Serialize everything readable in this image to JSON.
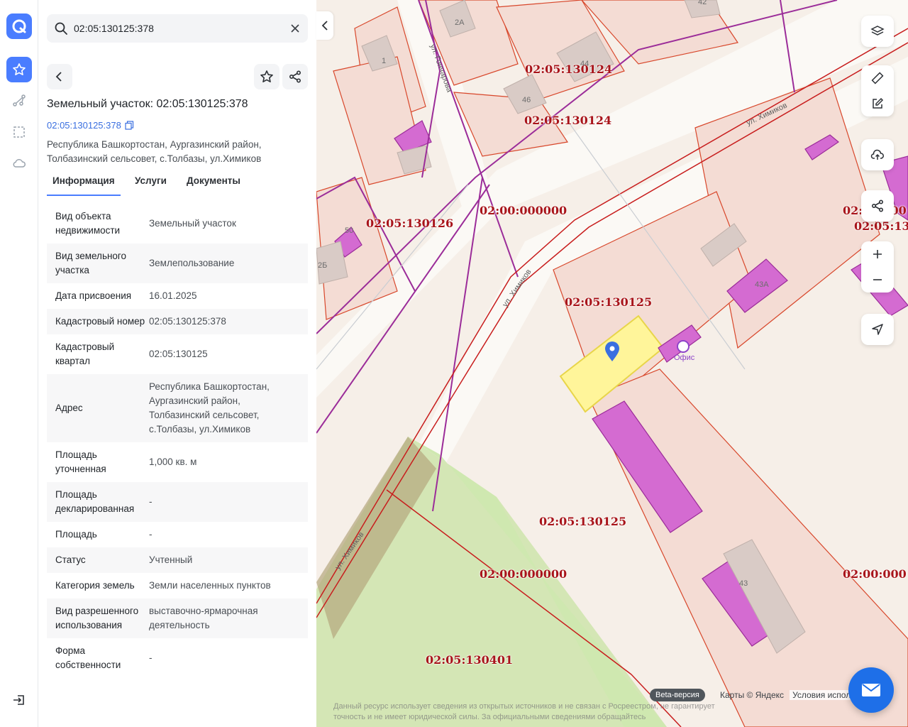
{
  "search": {
    "value": "02:05:130125:378",
    "placeholder": ""
  },
  "object": {
    "title": "Земельный участок: 02:05:130125:378",
    "cadastral_link": "02:05:130125:378",
    "address": "Республика Башкортостан, Аургазинский район, Толбазинский сельсовет, с.Толбазы, ул.Химиков"
  },
  "tabs": [
    {
      "label": "Информация"
    },
    {
      "label": "Услуги"
    },
    {
      "label": "Документы"
    }
  ],
  "info_rows": [
    {
      "key": "Вид объекта недвижимости",
      "value": "Земельный участок"
    },
    {
      "key": "Вид земельного участка",
      "value": "Землепользование"
    },
    {
      "key": "Дата присвоения",
      "value": "16.01.2025"
    },
    {
      "key": "Кадастровый номер",
      "value": "02:05:130125:378"
    },
    {
      "key": "Кадастровый квартал",
      "value": "02:05:130125"
    },
    {
      "key": "Адрес",
      "value": "Республика Башкортостан, Аургазинский район, Толбазинский сельсовет, с.Толбазы, ул.Химиков"
    },
    {
      "key": "Площадь уточненная",
      "value": "1,000 кв. м"
    },
    {
      "key": "Площадь декларированная",
      "value": "-"
    },
    {
      "key": "Площадь",
      "value": "-"
    },
    {
      "key": "Статус",
      "value": "Учтенный"
    },
    {
      "key": "Категория земель",
      "value": "Земли населенных пунктов"
    },
    {
      "key": "Вид разрешенного использования",
      "value": "выставочно-ярмарочная деятельность"
    },
    {
      "key": "Форма собственности",
      "value": "-"
    }
  ],
  "map": {
    "quarter_labels": [
      "02:05:130124",
      "02:05:130124",
      "02:00:000000",
      "02:05:130126",
      "02:05:130125",
      "02:05:130125",
      "02:00:000000",
      "02:05:130401",
      "02:00:000",
      "02:05:13",
      "02:00:000"
    ],
    "building_labels": [
      "2А",
      "42",
      "1",
      "44",
      "46",
      "50",
      "2Б",
      "43А",
      "43"
    ],
    "streets": [
      "ул. Гончарова",
      "ул. Химиков",
      "ул. Химиков",
      "ул. Химиков"
    ],
    "poi": "Офис",
    "beta": "Beta-версия",
    "attribution": "Карты © Яндекс",
    "terms": "Условия испол",
    "disclaimer": "Данный ресурс использует сведения из открытых источников и не связан с Росреестром, не гарантирует точность и не имеет юридической силы. За официальными сведениями обращайтесь"
  },
  "colors": {
    "accent": "#4a7dff",
    "parcel_border": "#d8472b",
    "quarter_label": "#a8141a",
    "highlight": "#fff59a",
    "building": "#d46bd1"
  }
}
